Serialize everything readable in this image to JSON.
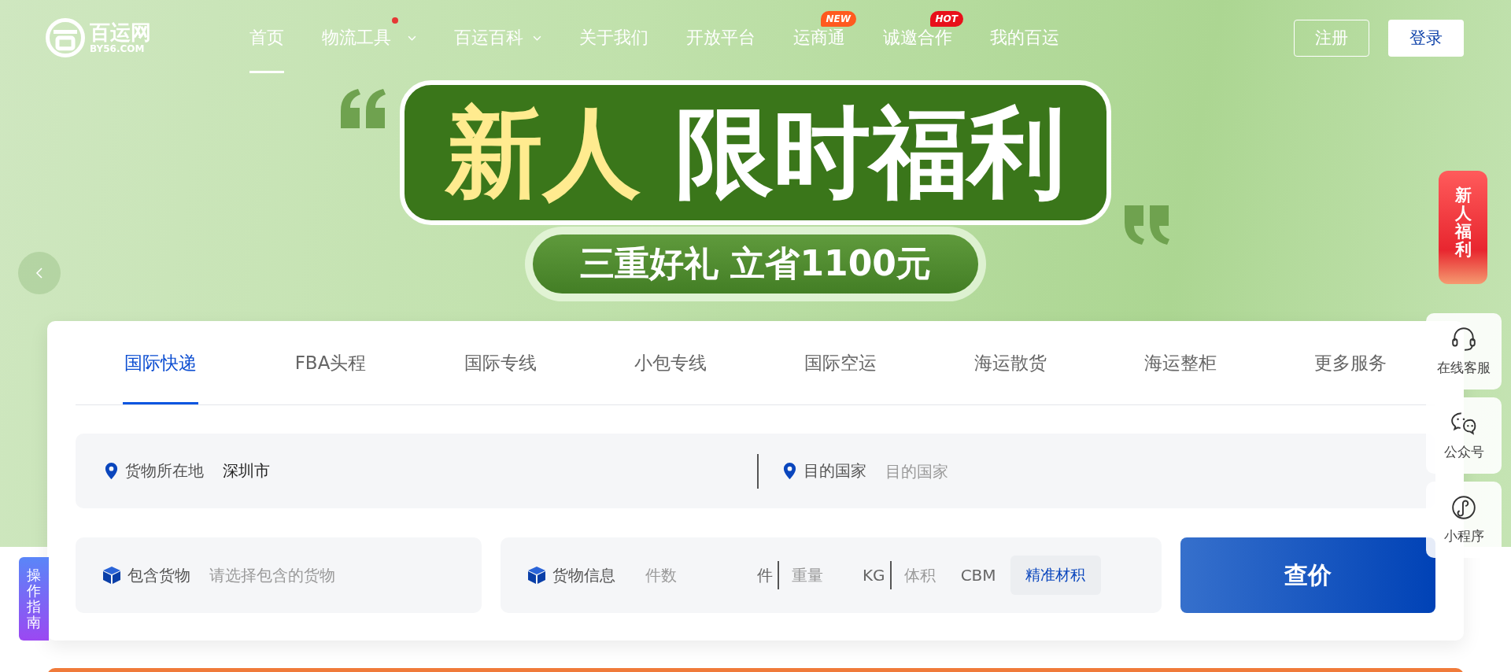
{
  "header": {
    "logo": {
      "name": "百运网",
      "domain": "BY56.COM"
    },
    "nav": [
      {
        "label": "首页",
        "selected": true,
        "dropdown": false,
        "dot": false
      },
      {
        "label": "物流工具",
        "selected": false,
        "dropdown": true,
        "dot": true
      },
      {
        "label": "百运百科",
        "selected": false,
        "dropdown": true,
        "dot": false
      },
      {
        "label": "关于我们",
        "selected": false,
        "dropdown": false,
        "dot": false
      },
      {
        "label": "开放平台",
        "selected": false,
        "dropdown": false,
        "dot": false
      },
      {
        "label": "运商通",
        "selected": false,
        "dropdown": false,
        "dot": false,
        "badge": {
          "text": "NEW",
          "color": "#ff5a1f"
        }
      },
      {
        "label": "诚邀合作",
        "selected": false,
        "dropdown": false,
        "dot": false,
        "badge": {
          "text": "HOT",
          "color": "#e8101a"
        }
      },
      {
        "label": "我的百运",
        "selected": false,
        "dropdown": false,
        "dot": false
      }
    ],
    "buttons": [
      {
        "label": "注册",
        "kind": "outline"
      },
      {
        "label": "登录",
        "kind": "solid"
      }
    ]
  },
  "banner": {
    "title_highlight": "新人",
    "title": "限时福利",
    "subtitle": "三重好礼 立省1100元"
  },
  "search": {
    "tabs": [
      {
        "label": "国际快递",
        "selected": true
      },
      {
        "label": "FBA头程",
        "selected": false
      },
      {
        "label": "国际专线",
        "selected": false
      },
      {
        "label": "小包专线",
        "selected": false
      },
      {
        "label": "国际空运",
        "selected": false
      },
      {
        "label": "海运散货",
        "selected": false
      },
      {
        "label": "海运整柜",
        "selected": false
      },
      {
        "label": "更多服务",
        "selected": false
      }
    ],
    "origin": {
      "label": "货物所在地",
      "value": "深圳市"
    },
    "destination": {
      "label": "目的国家",
      "placeholder": "目的国家"
    },
    "goods": {
      "label": "包含货物",
      "placeholder": "请选择包含的货物"
    },
    "cargo": {
      "label": "货物信息",
      "fields": [
        {
          "placeholder": "件数",
          "unit": "件"
        },
        {
          "placeholder": "重量",
          "unit": "KG"
        },
        {
          "placeholder": "体积",
          "unit": "CBM"
        }
      ],
      "action": "精准材积"
    },
    "submit": "查价"
  },
  "side_promo": {
    "text": "新人福利"
  },
  "side_tools": [
    {
      "label": "在线客服",
      "kind": "headset"
    },
    {
      "label": "公众号",
      "kind": "wechat"
    },
    {
      "label": "小程序",
      "kind": "miniapp"
    }
  ],
  "guide_tab": "操作指南"
}
